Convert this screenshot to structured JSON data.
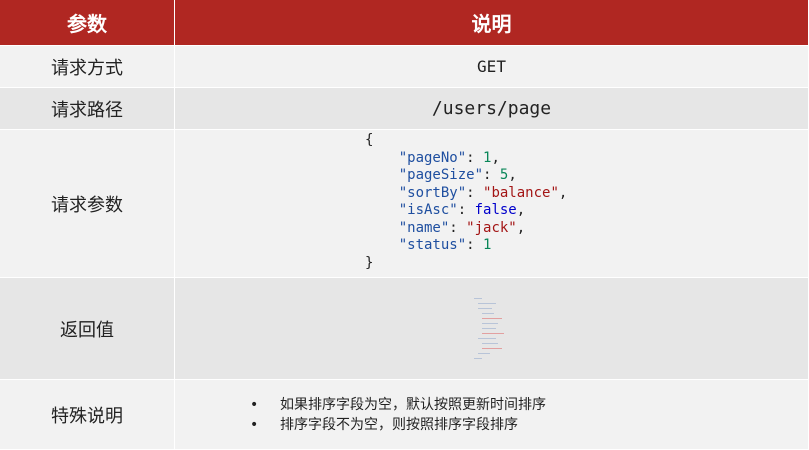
{
  "header": {
    "param": "参数",
    "desc": "说明"
  },
  "rows": {
    "method": {
      "label": "请求方式",
      "value": "GET"
    },
    "path": {
      "label": "请求路径",
      "value": "/users/page"
    },
    "params": {
      "label": "请求参数",
      "open_brace": "{",
      "close_brace": "}",
      "fields": [
        {
          "key": "\"pageNo\"",
          "value": "1",
          "type": "number"
        },
        {
          "key": "\"pageSize\"",
          "value": "5",
          "type": "number"
        },
        {
          "key": "\"sortBy\"",
          "value": "\"balance\"",
          "type": "string"
        },
        {
          "key": "\"isAsc\"",
          "value": "false",
          "type": "bool"
        },
        {
          "key": "\"name\"",
          "value": "\"jack\"",
          "type": "string"
        },
        {
          "key": "\"status\"",
          "value": "1",
          "type": "number"
        }
      ]
    },
    "return": {
      "label": "返回值"
    },
    "notes": {
      "label": "特殊说明",
      "bullet": "•",
      "items": [
        "如果排序字段为空，默认按照更新时间排序",
        "排序字段不为空，则按照排序字段排序"
      ]
    }
  }
}
